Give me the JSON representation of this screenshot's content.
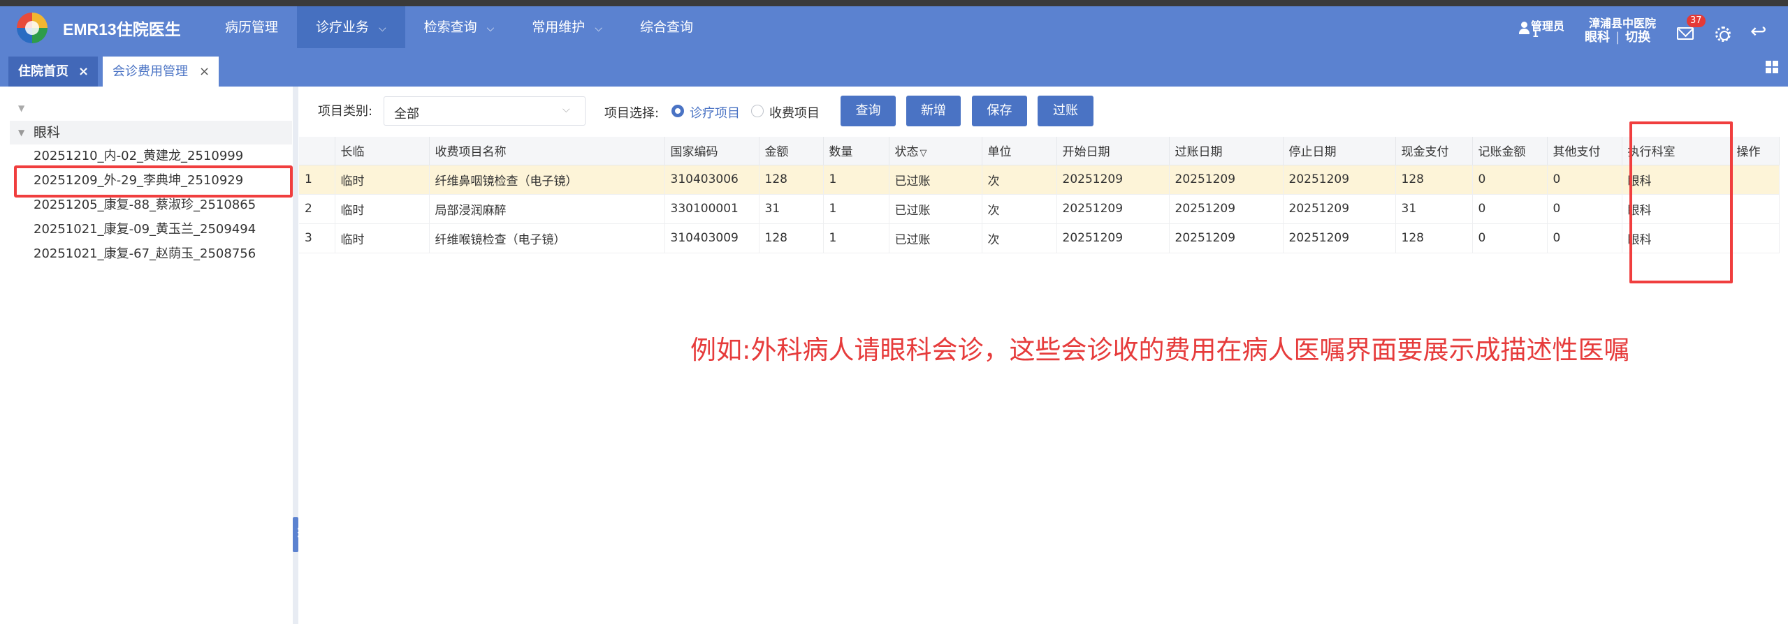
{
  "app": {
    "title": "EMR13住院医生"
  },
  "nav": {
    "items": [
      {
        "label": "病历管理",
        "active": false,
        "dropdown": false
      },
      {
        "label": "诊疗业务",
        "active": true,
        "dropdown": true
      },
      {
        "label": "检索查询",
        "active": false,
        "dropdown": true
      },
      {
        "label": "常用维护",
        "active": false,
        "dropdown": true
      },
      {
        "label": "综合查询",
        "active": false,
        "dropdown": false
      }
    ]
  },
  "user": {
    "role": "管理员",
    "number": "1",
    "hospital": "漳浦县中医院",
    "dept": "眼科",
    "switch_label": "切换",
    "separator": "|",
    "mail_count": "37"
  },
  "tabs": [
    {
      "label": "住院首页",
      "active": false
    },
    {
      "label": "会诊费用管理",
      "active": true
    }
  ],
  "tree": {
    "node": "眼科",
    "patients": [
      "20251210_内-02_黄建龙_2510999",
      "20251209_外-29_李典坤_2510929",
      "20251205_康复-88_蔡淑珍_2510865",
      "20251021_康复-09_黄玉兰_2509494",
      "20251021_康复-67_赵荫玉_2508756"
    ],
    "selected_index": 1
  },
  "filters": {
    "category_label": "项目类别:",
    "category_value": "全部",
    "selection_label": "项目选择:",
    "options": [
      {
        "label": "诊疗项目",
        "checked": true
      },
      {
        "label": "收费项目",
        "checked": false
      }
    ]
  },
  "buttons": {
    "query": "查询",
    "add": "新增",
    "save": "保存",
    "post": "过账"
  },
  "table": {
    "columns": [
      "",
      "长临",
      "收费项目名称",
      "国家编码",
      "金额",
      "数量",
      "状态",
      "单位",
      "开始日期",
      "过账日期",
      "停止日期",
      "现金支付",
      "记账金额",
      "其他支付",
      "执行科室",
      "操作"
    ],
    "rows": [
      [
        "1",
        "临时",
        "纤维鼻咽镜检查（电子镜）",
        "310403006",
        "128",
        "1",
        "已过账",
        "次",
        "20251209",
        "20251209",
        "20251209",
        "128",
        "0",
        "0",
        "眼科",
        ""
      ],
      [
        "2",
        "临时",
        "局部浸润麻醉",
        "330100001",
        "31",
        "1",
        "已过账",
        "次",
        "20251209",
        "20251209",
        "20251209",
        "31",
        "0",
        "0",
        "眼科",
        ""
      ],
      [
        "3",
        "临时",
        "纤维喉镜检查（电子镜）",
        "310403009",
        "128",
        "1",
        "已过账",
        "次",
        "20251209",
        "20251209",
        "20251209",
        "128",
        "0",
        "0",
        "眼科",
        ""
      ]
    ],
    "highlight_row": 0
  },
  "annotation": "例如:外科病人请眼科会诊，这些会诊收的费用在病人医嘱界面要展示成描述性医嘱",
  "colors": {
    "nav_bg": "#5b82d0",
    "accent": "#4a73c4",
    "highlight_row": "#fdf4d8",
    "annotation": "#e63b3b"
  }
}
